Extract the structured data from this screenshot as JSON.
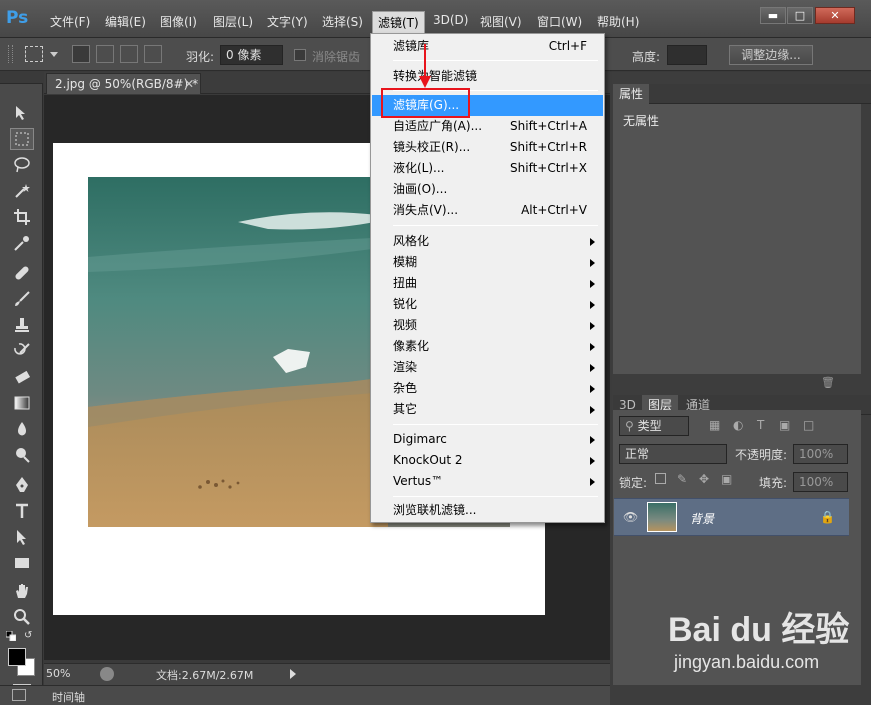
{
  "app": {
    "logo": "Ps"
  },
  "menubar": {
    "items": [
      "文件(F)",
      "编辑(E)",
      "图像(I)",
      "图层(L)",
      "文字(Y)",
      "选择(S)",
      "滤镜(T)",
      "3D(D)",
      "视图(V)",
      "窗口(W)",
      "帮助(H)"
    ],
    "active": "滤镜(T)"
  },
  "options": {
    "feather_label": "羽化:",
    "feather_value": "0 像素",
    "antialias_label": "消除锯齿",
    "height_label": "高度:",
    "refine_edge": "调整边缘..."
  },
  "document": {
    "tab_title": "2.jpg @ 50%(RGB/8#) *",
    "zoom": "50%",
    "doc_info": "文档:2.67M/2.67M"
  },
  "timeline": {
    "label": "时间轴"
  },
  "properties": {
    "tab": "属性",
    "body": "无属性"
  },
  "layers": {
    "tabs": [
      "3D",
      "图层",
      "通道"
    ],
    "filter_kind": "类型",
    "blend_mode": "正常",
    "opacity_label": "不透明度:",
    "opacity_value": "100%",
    "lock_label": "锁定:",
    "fill_label": "填充:",
    "fill_value": "100%",
    "layer_name": "背景"
  },
  "filter_menu": {
    "last_filter": {
      "label": "滤镜库",
      "shortcut": "Ctrl+F"
    },
    "convert_smart": "转换为智能滤镜",
    "filter_gallery": "滤镜库(G)...",
    "group1": [
      {
        "label": "自适应广角(A)...",
        "shortcut": "Shift+Ctrl+A"
      },
      {
        "label": "镜头校正(R)...",
        "shortcut": "Shift+Ctrl+R"
      },
      {
        "label": "液化(L)...",
        "shortcut": "Shift+Ctrl+X"
      },
      {
        "label": "油画(O)...",
        "shortcut": ""
      },
      {
        "label": "消失点(V)...",
        "shortcut": "Alt+Ctrl+V"
      }
    ],
    "submenus": [
      "风格化",
      "模糊",
      "扭曲",
      "锐化",
      "视频",
      "像素化",
      "渲染",
      "杂色",
      "其它"
    ],
    "plugins": [
      "Digimarc",
      "KnockOut 2",
      "Vertus™"
    ],
    "browse_online": "浏览联机滤镜..."
  },
  "watermark": {
    "brand": "Bai du 经验",
    "url": "jingyan.baidu.com"
  },
  "colors": {
    "highlight": "#3399ff",
    "callout": "#e8141c",
    "ps_blue": "#3f9ee8"
  }
}
